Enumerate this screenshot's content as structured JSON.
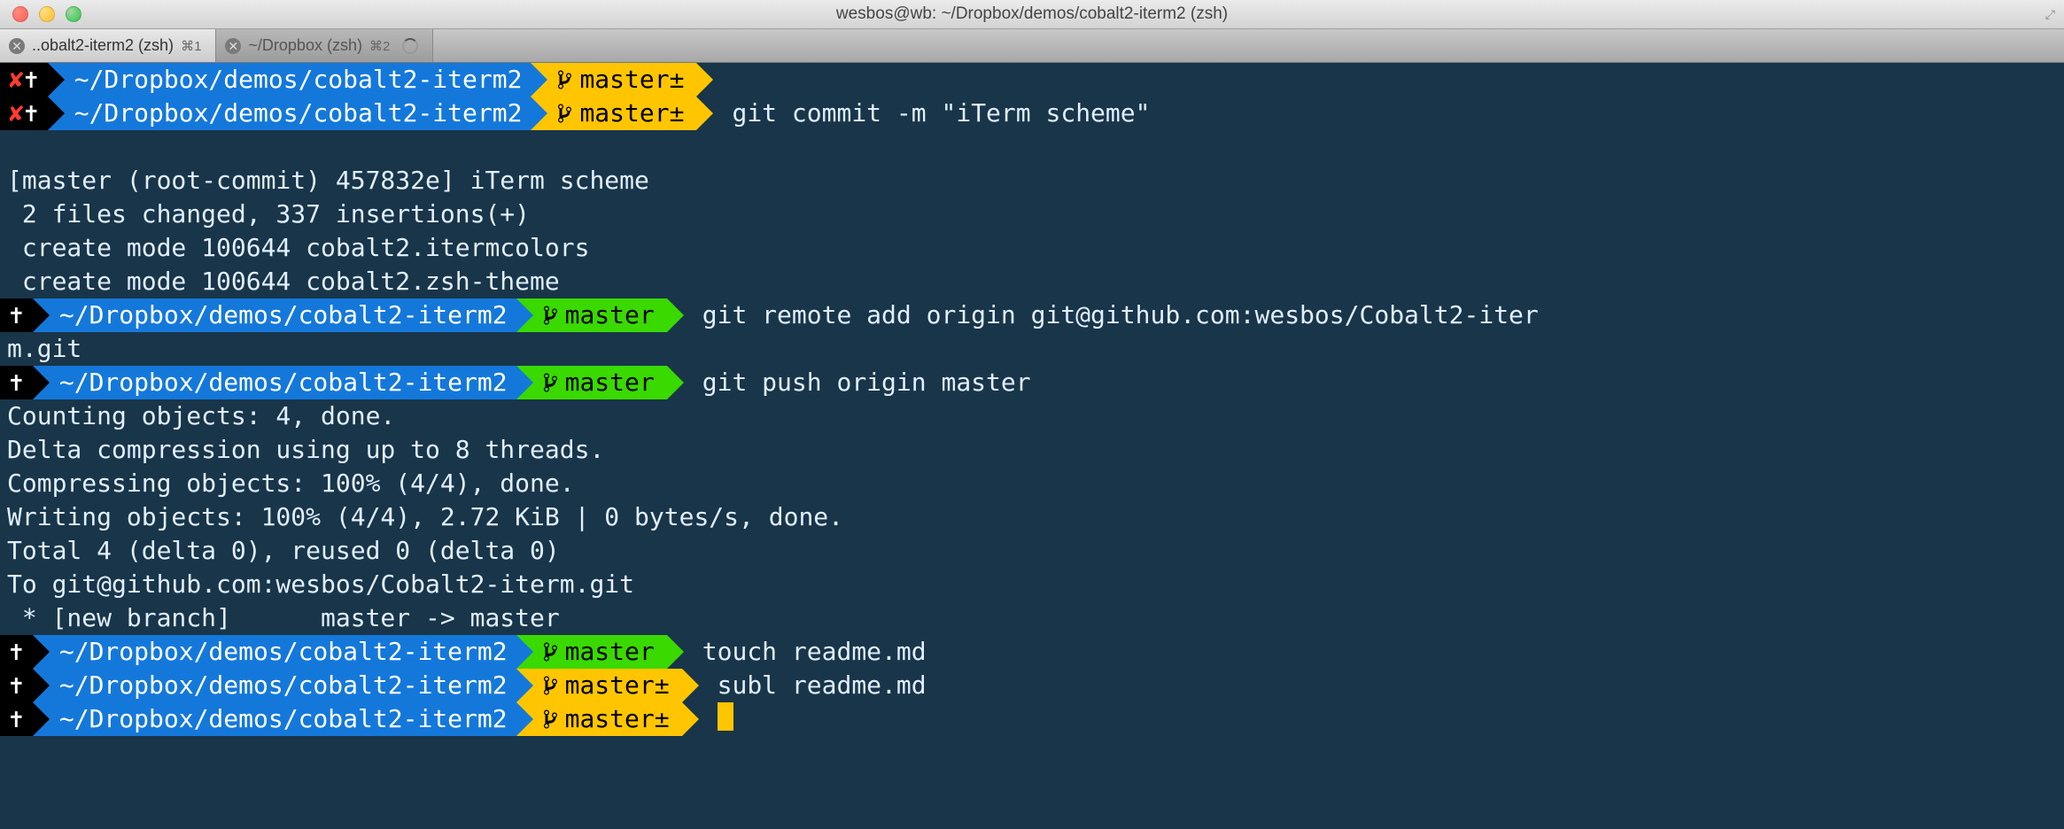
{
  "window": {
    "title": "wesbos@wb: ~/Dropbox/demos/cobalt2-iterm2 (zsh)"
  },
  "tabs": [
    {
      "label": "..obalt2-iterm2 (zsh)",
      "shortcut": "⌘1",
      "active": true
    },
    {
      "label": "~/Dropbox (zsh)",
      "shortcut": "⌘2",
      "active": false,
      "loading": true
    }
  ],
  "lines": [
    {
      "type": "prompt",
      "status": "dirty",
      "status_x": "✘",
      "status_cross": "✝",
      "path": "~/Dropbox/demos/cobalt2-iterm2",
      "branch_color": "yellow",
      "branch": "master",
      "branch_dirty": "±",
      "cmd": ""
    },
    {
      "type": "prompt",
      "status": "dirty",
      "status_x": "✘",
      "status_cross": "✝",
      "path": "~/Dropbox/demos/cobalt2-iterm2",
      "branch_color": "yellow",
      "branch": "master",
      "branch_dirty": "±",
      "cmd": "git commit -m \"iTerm scheme\""
    },
    {
      "type": "blank"
    },
    {
      "type": "output",
      "text": "[master (root-commit) 457832e] iTerm scheme"
    },
    {
      "type": "output",
      "text": " 2 files changed, 337 insertions(+)"
    },
    {
      "type": "output",
      "text": " create mode 100644 cobalt2.itermcolors"
    },
    {
      "type": "output",
      "text": " create mode 100644 cobalt2.zsh-theme"
    },
    {
      "type": "prompt",
      "status": "clean",
      "status_cross": "✝",
      "path": "~/Dropbox/demos/cobalt2-iterm2",
      "branch_color": "green",
      "branch": "master",
      "cmd": "git remote add origin git@github.com:wesbos/Cobalt2-iter"
    },
    {
      "type": "output",
      "text": "m.git"
    },
    {
      "type": "prompt",
      "status": "clean",
      "status_cross": "✝",
      "path": "~/Dropbox/demos/cobalt2-iterm2",
      "branch_color": "green",
      "branch": "master",
      "cmd": "git push origin master"
    },
    {
      "type": "output",
      "text": "Counting objects: 4, done."
    },
    {
      "type": "output",
      "text": "Delta compression using up to 8 threads."
    },
    {
      "type": "output",
      "text": "Compressing objects: 100% (4/4), done."
    },
    {
      "type": "output",
      "text": "Writing objects: 100% (4/4), 2.72 KiB | 0 bytes/s, done."
    },
    {
      "type": "output",
      "text": "Total 4 (delta 0), reused 0 (delta 0)"
    },
    {
      "type": "output",
      "text": "To git@github.com:wesbos/Cobalt2-iterm.git"
    },
    {
      "type": "output",
      "text": " * [new branch]      master -> master"
    },
    {
      "type": "prompt",
      "status": "clean",
      "status_cross": "✝",
      "path": "~/Dropbox/demos/cobalt2-iterm2",
      "branch_color": "green",
      "branch": "master",
      "cmd": "touch readme.md"
    },
    {
      "type": "prompt",
      "status": "clean",
      "status_cross": "✝",
      "path": "~/Dropbox/demos/cobalt2-iterm2",
      "branch_color": "yellow",
      "branch": "master",
      "branch_dirty": "±",
      "cmd": "subl readme.md"
    },
    {
      "type": "prompt",
      "status": "clean",
      "status_cross": "✝",
      "path": "~/Dropbox/demos/cobalt2-iterm2",
      "branch_color": "yellow",
      "branch": "master",
      "branch_dirty": "±",
      "cmd": "",
      "cursor": true
    }
  ],
  "icons": {
    "branch": "⎇"
  }
}
